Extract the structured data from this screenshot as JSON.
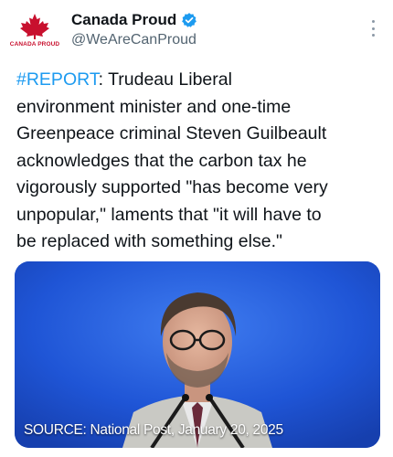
{
  "author": {
    "display_name": "Canada Proud",
    "handle": "@WeAreCanProud",
    "avatar_text": "CANADA PROUD",
    "verified_color": "#1d9bf0",
    "brand_color": "#c8102e"
  },
  "tweet": {
    "hashtag": "#REPORT",
    "text": ": Trudeau Liberal\nenvironment minister and one-time\nGreenpeace criminal Steven Guilbeault\nacknowledges that the carbon tax he\nvigorously supported \"has become very\nunpopular,\" laments that \"it will have to\nbe replaced with something else.\""
  },
  "media": {
    "caption": "SOURCE: National Post, January 20, 2025",
    "background_color": "#1a4fd0"
  },
  "icons": {
    "more": "more-vertical-icon",
    "verified": "verified-badge-icon",
    "avatar": "maple-leaf-icon"
  }
}
